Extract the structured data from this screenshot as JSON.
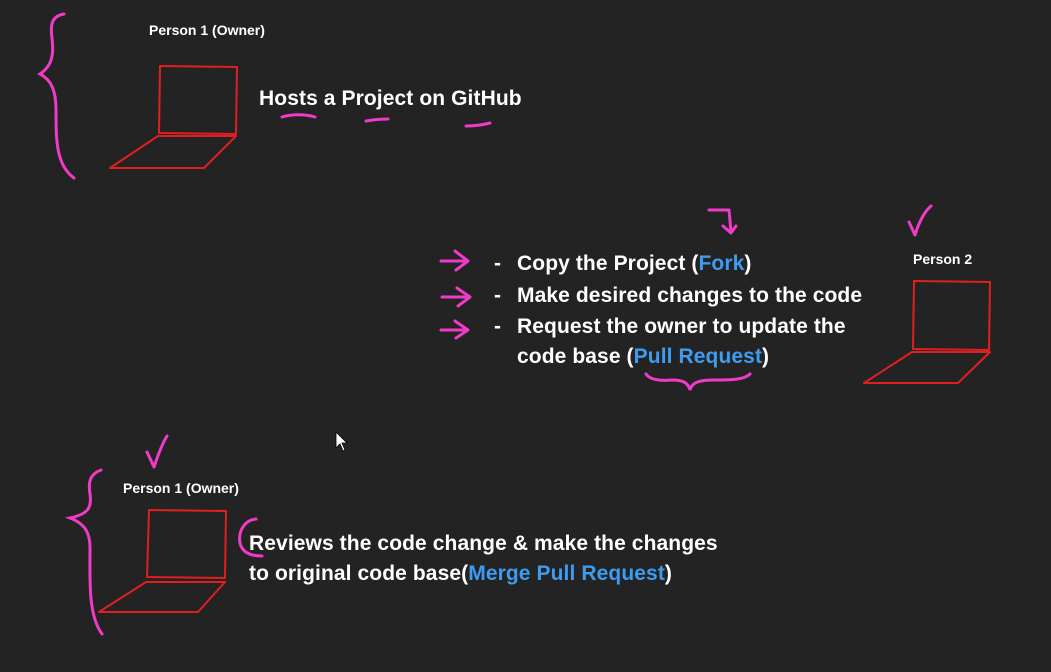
{
  "colors": {
    "background": "#232323",
    "text": "#ffffff",
    "highlight": "#3d9cf0",
    "laptop": "#e02020",
    "annotation": "#f03ac8"
  },
  "section_top": {
    "label": "Person 1 (Owner)",
    "text_parts": [
      "Hosts a Project on GitHub"
    ]
  },
  "section_middle": {
    "label": "Person 2",
    "items": [
      {
        "dash": "-",
        "text": "Copy the Project (",
        "highlight": "Fork",
        "suffix": ")"
      },
      {
        "dash": "-",
        "text": "Make desired changes to the code",
        "highlight": "",
        "suffix": ""
      },
      {
        "dash": "-",
        "text": "Request the owner to update the",
        "highlight": "",
        "suffix": ""
      },
      {
        "dash": "",
        "text": "code base (",
        "highlight": "Pull Request",
        "suffix": ")"
      }
    ]
  },
  "section_bottom": {
    "label": "Person 1 (Owner)",
    "line1": "Reviews the code change & make the changes",
    "line2_text": "to original code base(",
    "line2_highlight": "Merge Pull Request",
    "line2_suffix": ")"
  },
  "icons": {
    "laptop": "laptop-icon",
    "arrow": "arrow-right-icon",
    "check": "checkmark-icon",
    "brace": "curly-brace-icon",
    "cursor": "mouse-cursor-icon"
  }
}
